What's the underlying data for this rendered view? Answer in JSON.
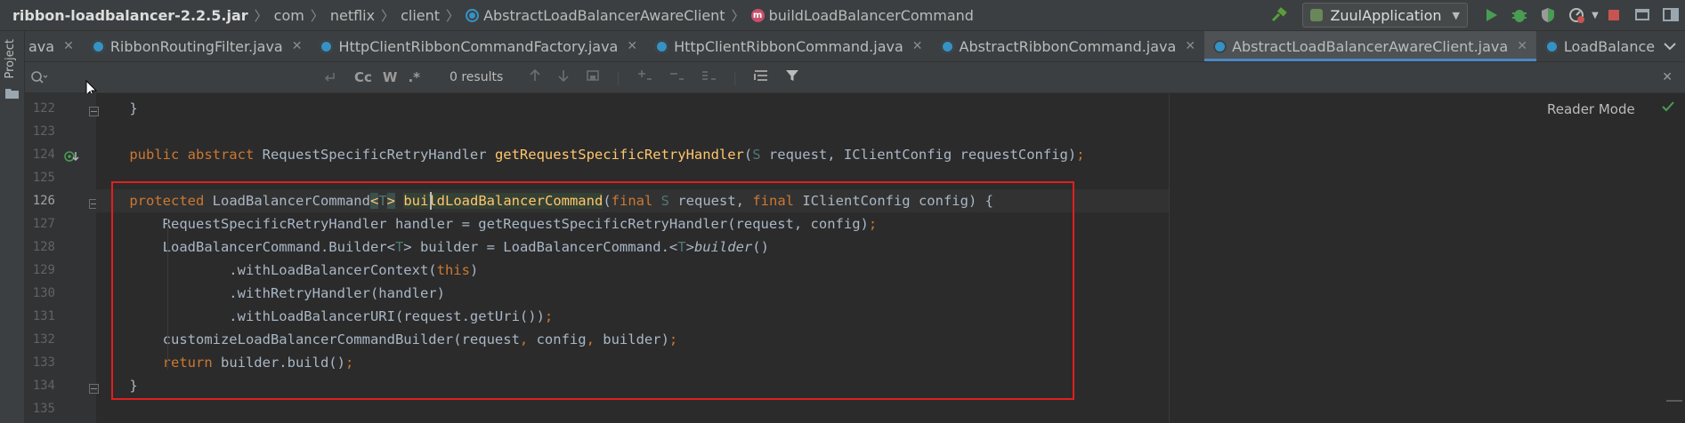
{
  "breadcrumb": [
    {
      "label": "ribbon-loadbalancer-2.2.5.jar",
      "icon": ""
    },
    {
      "label": "com",
      "icon": ""
    },
    {
      "label": "netflix",
      "icon": ""
    },
    {
      "label": "client",
      "icon": ""
    },
    {
      "label": "AbstractLoadBalancerAwareClient",
      "icon": "class-icon"
    },
    {
      "label": "buildLoadBalancerCommand",
      "icon": "method-icon"
    }
  ],
  "toolbar": {
    "run_config": "ZuulApplication",
    "method_icon_letter": "m"
  },
  "sidebar": {
    "project_label": "Project"
  },
  "tabs": [
    {
      "label": "ava",
      "active": false
    },
    {
      "label": "RibbonRoutingFilter.java",
      "active": false
    },
    {
      "label": "HttpClientRibbonCommandFactory.java",
      "active": false
    },
    {
      "label": "HttpClientRibbonCommand.java",
      "active": false
    },
    {
      "label": "AbstractRibbonCommand.java",
      "active": false
    },
    {
      "label": "AbstractLoadBalancerAwareClient.java",
      "active": true
    },
    {
      "label": "LoadBalancerCommand.java",
      "active": false
    }
  ],
  "search": {
    "results": "0 results",
    "case_label": "Cc",
    "word_label": "W",
    "regex_label": ".*"
  },
  "editor": {
    "reader_mode": "Reader Mode",
    "line_numbers": [
      "122",
      "123",
      "124",
      "125",
      "126",
      "127",
      "128",
      "129",
      "130",
      "131",
      "132",
      "133",
      "134",
      "135"
    ],
    "current_line": "126"
  },
  "colors": {
    "background": "#2b2b2b",
    "keyword": "#cc7832",
    "function": "#ffc66d",
    "highlight_box": "#e11f1f",
    "active_tab_underline": "#4a88c7"
  }
}
